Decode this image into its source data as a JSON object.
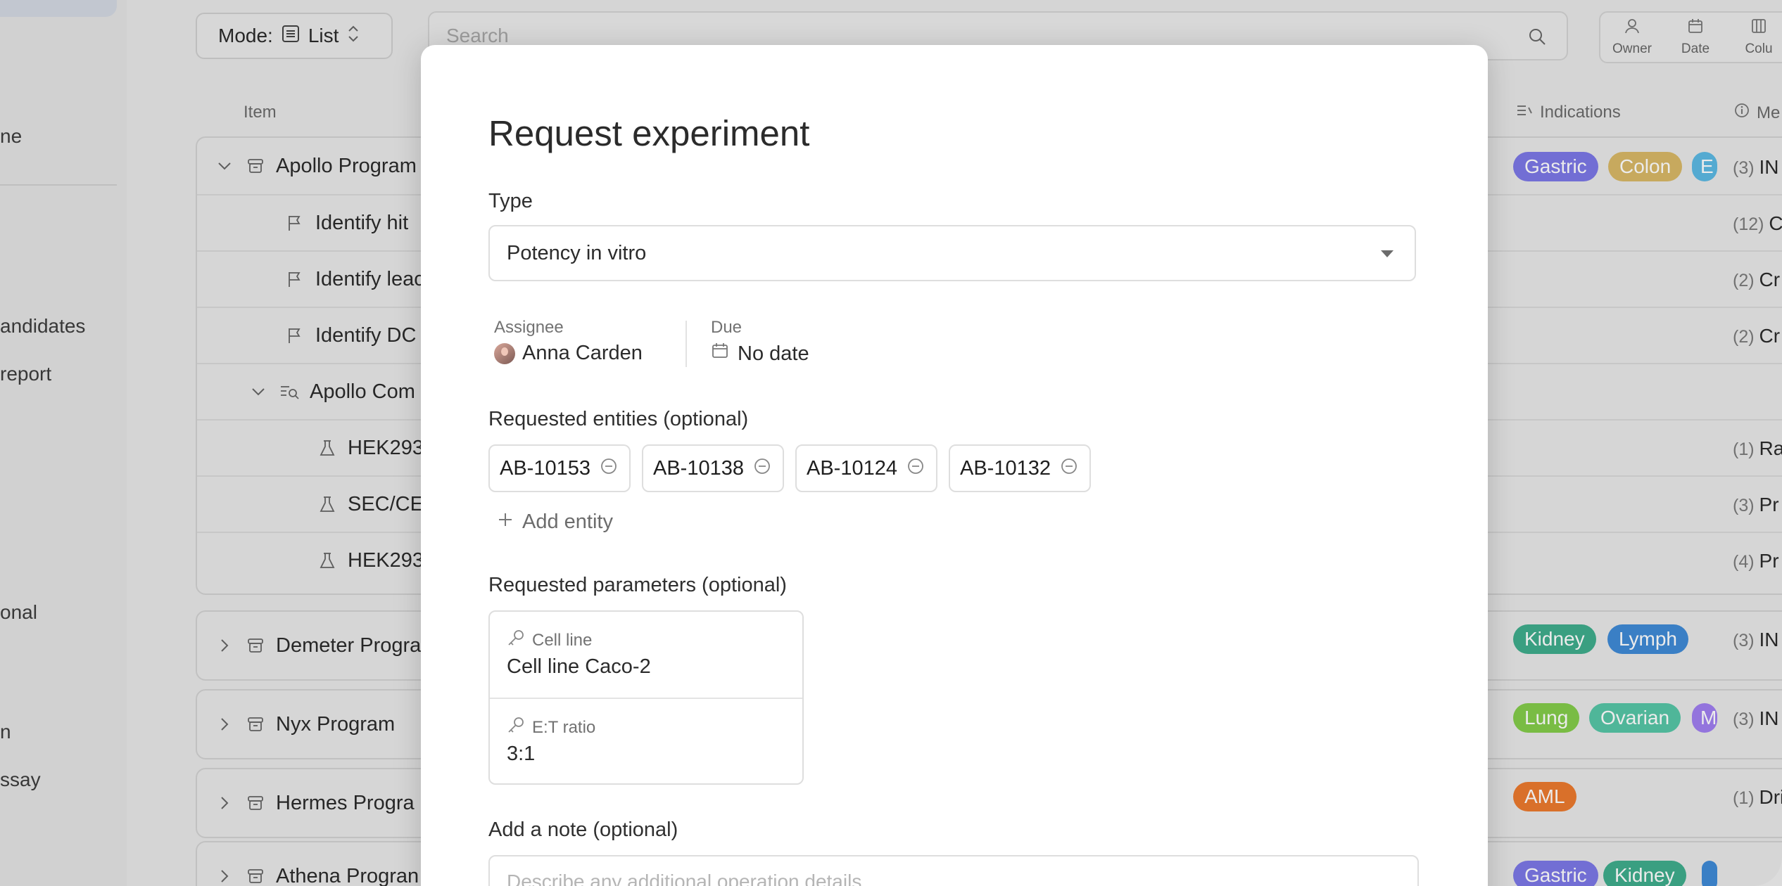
{
  "sidebar": {
    "items": [
      {
        "label": "ne"
      },
      {
        "label": "andidates"
      },
      {
        "label": " report"
      },
      {
        "label": "onal"
      },
      {
        "label": "n"
      },
      {
        "label": "ssay"
      }
    ]
  },
  "toolbar": {
    "mode_prefix": "Mode:",
    "mode_value": "List",
    "search_placeholder": "Search",
    "buttons": [
      {
        "label": "Owner"
      },
      {
        "label": "Date"
      },
      {
        "label": "Colu"
      }
    ]
  },
  "table": {
    "headers": {
      "item": "Item",
      "indications": "Indications",
      "meta": "Me"
    },
    "rows": [
      {
        "label": "Apollo Program",
        "count": "(3)",
        "value": "IN"
      },
      {
        "label": "Identify hit",
        "count": "(12)",
        "value": "C"
      },
      {
        "label": "Identify leac",
        "count": "(2)",
        "value": "Cr"
      },
      {
        "label": "Identify DC",
        "count": "(2)",
        "value": "Cr"
      },
      {
        "label": "Apollo Com",
        "count": "",
        "value": ""
      },
      {
        "label": "HEK293",
        "count": "(1)",
        "value": "Ra"
      },
      {
        "label": "SEC/CE",
        "count": "(3)",
        "value": "Pr"
      },
      {
        "label": "HEK293",
        "count": "(4)",
        "value": "Pr"
      },
      {
        "label": "Demeter Progra",
        "count": "(3)",
        "value": "IN"
      },
      {
        "label": "Nyx Program",
        "count": "(3)",
        "value": "IN"
      },
      {
        "label": "Hermes Progra",
        "count": "(1)",
        "value": "Dri"
      },
      {
        "label": "Athena Progran",
        "count": "",
        "value": ""
      }
    ],
    "tags": {
      "apollo": [
        "Gastric",
        "Colon",
        "E"
      ],
      "demeter": [
        "Kidney",
        "Lymph"
      ],
      "nyx": [
        "Lung",
        "Ovarian",
        "M"
      ],
      "hermes": [
        "AML"
      ],
      "athena": [
        "Gastric",
        "Kidney"
      ]
    },
    "tag_colors": {
      "Gastric": "#7c78e6",
      "Colon": "#d8b866",
      "E": "#5cb9e3",
      "Kidney": "#3fad8c",
      "Lymph": "#3f8ad6",
      "Lung": "#84cc4a",
      "Ovarian": "#56c6a6",
      "M": "#a07ef0",
      "AML": "#ec7a2e"
    }
  },
  "modal": {
    "title": "Request experiment",
    "type_label": "Type",
    "type_value": "Potency in vitro",
    "assignee_label": "Assignee",
    "assignee_value": "Anna Carden",
    "due_label": "Due",
    "due_value": "No date",
    "entities_label": "Requested entities (optional)",
    "entities": [
      "AB-10153",
      "AB-10138",
      "AB-10124",
      "AB-10132"
    ],
    "add_entity_label": "Add entity",
    "params_label": "Requested parameters (optional)",
    "params": [
      {
        "label": "Cell line",
        "value": "Cell line Caco-2"
      },
      {
        "label": "E:T ratio",
        "value": "3:1"
      }
    ],
    "note_label": "Add a note (optional)",
    "note_placeholder": "Describe any additional operation details"
  }
}
